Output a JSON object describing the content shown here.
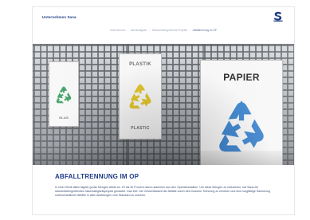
{
  "header": {
    "brand": "Unternehmen Sana",
    "logo_icon": "sana-logo-icon",
    "brand_color": "#1f3f84"
  },
  "breadcrumbs": [
    "Unternehmen",
    "Nachhaltigkeit",
    "Standortübergreifende Projekte",
    "Abfalltrennung im OP"
  ],
  "hero": {
    "labels": {
      "glass_top": "",
      "glass_bottom": "GLAS",
      "plastic_top": "PLASTIK",
      "plastic_bottom": "PLASTIC",
      "paper_top": "PAPIER"
    },
    "icons": {
      "glass": "recycle-icon",
      "plastic": "recycle-icon",
      "paper": "recycle-icon"
    },
    "colors": {
      "glass_recycle": "#3f9f62",
      "plastic_recycle": "#e1c62d",
      "paper_recycle": "#3f86cf"
    }
  },
  "article": {
    "title": "ABFALLTRENNUNG IM OP",
    "body": "In einer Klinik fallen täglich große Mengen Abfall an. 20 bis 30 Prozent davon stammen aus den Operationssälen. Um diese Mengen zu reduzieren, hat Sana ein standortübergreifendes Nachhaltigkeitsprojekt gestartet. Das Ziel: Die Verwertbarkeit der Abfälle durch eine bessere Trennung zu erhöhen und eine sorgfältige Sammlung unterschiedlicher Abfälle in allen Abteilungen zum Standard zu machen."
  }
}
